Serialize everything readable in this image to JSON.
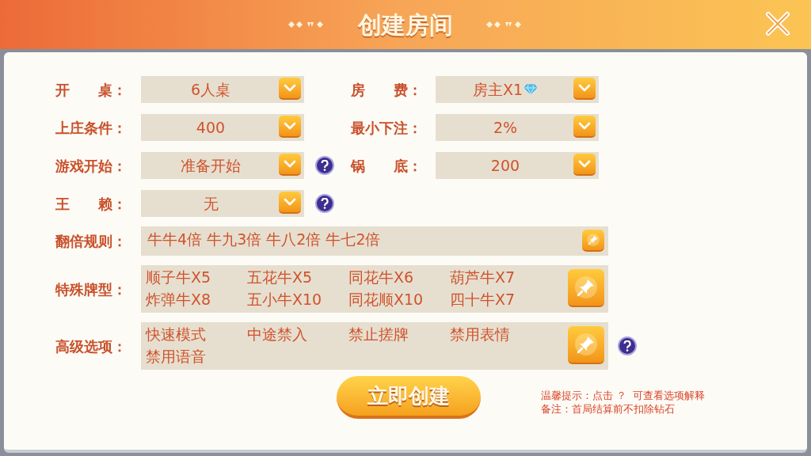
{
  "header": {
    "title": "创建房间"
  },
  "dropdown_rows": [
    [
      {
        "label": "开　　桌：",
        "value": "6人桌",
        "help": false
      },
      {
        "label": "房　　费：",
        "value": "房主X1",
        "gem": true,
        "help": false
      }
    ],
    [
      {
        "label": "上庄条件：",
        "value": "400",
        "help": false
      },
      {
        "label": "最小下注：",
        "value": "2%",
        "help": false
      }
    ],
    [
      {
        "label": "游戏开始：",
        "value": "准备开始",
        "help": true
      },
      {
        "label": "锅　　底：",
        "value": "200",
        "help": false
      }
    ],
    [
      {
        "label": "王　　赖：",
        "value": "无",
        "help": true
      }
    ]
  ],
  "option_groups": [
    {
      "label": "翻倍规则：",
      "kind": "inline",
      "items": [
        "牛牛4倍 牛九3倍 牛八2倍 牛七2倍"
      ],
      "help": false
    },
    {
      "label": "特殊牌型：",
      "kind": "grid",
      "items": [
        "顺子牛X5",
        "五花牛X5",
        "同花牛X6",
        "葫芦牛X7",
        "炸弹牛X8",
        "五小牛X10",
        "同花顺X10",
        "四十牛X7"
      ],
      "help": false
    },
    {
      "label": "高级选项：",
      "kind": "grid",
      "items": [
        "快速模式",
        "中途禁入",
        "禁止搓牌",
        "禁用表情",
        "禁用语音"
      ],
      "help": true
    }
  ],
  "create_button": "立即创建",
  "notes": [
    "温馨提示：点击 ？  可查看选项解释",
    "备注：首局结算前不扣除钻石"
  ]
}
